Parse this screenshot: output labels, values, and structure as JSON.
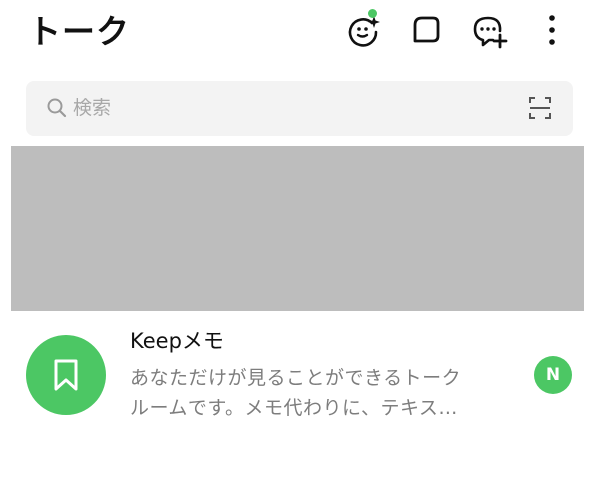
{
  "header": {
    "title": "トーク",
    "icons": [
      "sparkle-face-icon",
      "square-chat-icon",
      "new-chat-icon",
      "more-vertical-icon"
    ],
    "notification_dot_color": "#4cc764"
  },
  "search": {
    "placeholder": "検索",
    "value": "",
    "icon": "search-icon",
    "scan_icon": "scan-icon"
  },
  "banner": {
    "color": "#bdbdbd"
  },
  "chats": [
    {
      "name": "Keepメモ",
      "preview_line1": "あなただけが見ることができるトーク",
      "preview_line2": "ルームです。メモ代わりに、テキス…",
      "avatar_icon": "bookmark-icon",
      "avatar_color": "#4cc764",
      "badge": "N",
      "badge_color": "#4cc764"
    }
  ],
  "accent_color": "#4cc764"
}
